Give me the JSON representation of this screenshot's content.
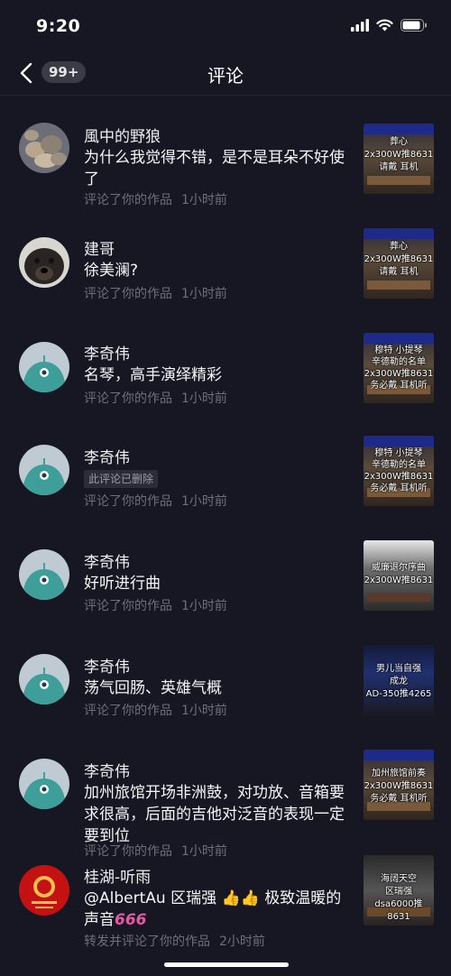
{
  "status": {
    "time": "9:20"
  },
  "nav": {
    "badge": "99+",
    "title": "评论"
  },
  "items": [
    {
      "name": "風中的野狼",
      "comment": "为什么我觉得不错，是不是耳朵不好使了",
      "action": "评论了你的作品",
      "time": "1小时前",
      "avatar": "stones-photo",
      "thumb": "葬心\n2x300W推8631\n请戴  耳机"
    },
    {
      "name": "建哥",
      "comment": "徐美澜?",
      "action": "评论了你的作品",
      "time": "1小时前",
      "avatar": "dog-photo",
      "thumb": "葬心\n2x300W推8631\n请戴  耳机"
    },
    {
      "name": "李奇伟",
      "comment": "名琴，高手演绎精彩",
      "action": "评论了你的作品",
      "time": "1小时前",
      "avatar": "default-avatar",
      "thumb": "穆特 小提琴\n辛德勒的名单\n2x300W推8631\n务必戴  耳机听"
    },
    {
      "name": "李奇伟",
      "deleted": "此评论已删除",
      "action": "评论了你的作品",
      "time": "1小时前",
      "avatar": "default-avatar",
      "thumb": "穆特 小提琴\n辛德勒的名单\n2x300W推8631\n务必戴  耳机听"
    },
    {
      "name": "李奇伟",
      "comment": "好听进行曲",
      "action": "评论了你的作品",
      "time": "1小时前",
      "avatar": "default-avatar",
      "thumb": "威廉退尔序曲\n2x300W推8631"
    },
    {
      "name": "李奇伟",
      "comment": "荡气回肠、英雄气概",
      "action": "评论了你的作品",
      "time": "1小时前",
      "avatar": "default-avatar",
      "thumb": "男儿当自强\n成龙\nAD-350推4265"
    },
    {
      "name": "李奇伟",
      "comment": "加州旅馆开场非洲鼓，对功放、音箱要求很高，后面的吉他对泛音的表现一定要到位",
      "action": "评论了你的作品",
      "time": "1小时前",
      "avatar": "default-avatar",
      "thumb": "加州旅馆前奏\n2x300W推8631\n务必戴  耳机听"
    },
    {
      "name": "桂湖-听雨",
      "comment": "@AlbertAu 区瑞强 👍👍 极致温暖的声音",
      "comment_tail": "666",
      "action": "转发并评论了你的作品",
      "time": "2小时前",
      "avatar": "red-seal",
      "thumb": "海阔天空\n区瑞强\ndsa6000推8631"
    }
  ]
}
